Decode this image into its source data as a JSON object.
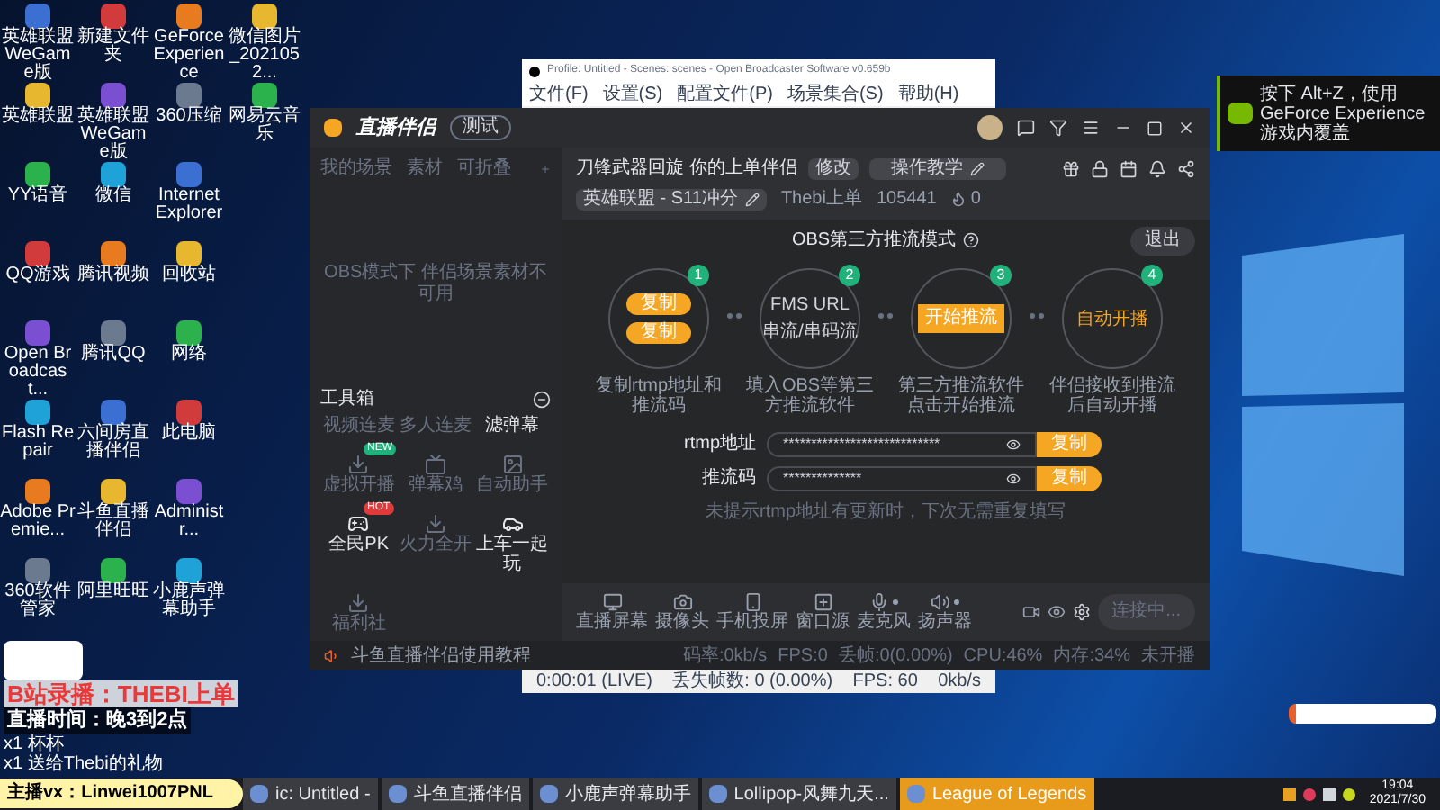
{
  "desktop": {
    "icon_columns": [
      [
        "英雄联盟WeGame版",
        "英雄联盟",
        "YY语音",
        "QQ游戏",
        "Open Broadcast...",
        "Flash Repair",
        "Adobe Premie...",
        "360软件管家"
      ],
      [
        "新建文件夹",
        "英雄联盟WeGame版",
        "微信",
        "腾讯视频",
        "腾讯QQ",
        "六间房直播伴侣",
        "斗鱼直播伴侣",
        "阿里旺旺"
      ],
      [
        "GeForce Experience",
        "360压缩",
        "Internet Explorer",
        "回收站",
        "网络",
        "此电脑",
        "Administr...",
        "小鹿声弹幕助手"
      ],
      [
        "微信图片_2021052...",
        "网易云音乐"
      ]
    ]
  },
  "notification": {
    "text": "按下 Alt+Z，使用 GeForce Experience 游戏内覆盖"
  },
  "obs_window": {
    "title": "Profile: Untitled - Scenes: scenes - Open Broadcaster Software v0.659b",
    "menu": [
      "文件(F)",
      "设置(S)",
      "配置文件(P)",
      "场景集合(S)",
      "帮助(H)"
    ],
    "status": [
      "0:00:01 (LIVE)",
      "丢失帧数: 0 (0.00%)",
      "FPS: 60",
      "0kb/s"
    ]
  },
  "app": {
    "name": "直播伴侣",
    "badge": "测试",
    "left_tabs": [
      "我的场景",
      "素材",
      "可折叠"
    ],
    "scene_note": "OBS模式下 伴侣场景素材不可用",
    "toolbox": {
      "title": "工具箱",
      "tools": [
        {
          "label": "视频连麦",
          "kind": "label_only",
          "disabled": true
        },
        {
          "label": "多人连麦",
          "kind": "label_only",
          "disabled": true
        },
        {
          "label": "滤弹幕",
          "kind": "label_only",
          "disabled": false
        },
        {
          "label": "虚拟开播",
          "kind": "icon",
          "badge": "NEW",
          "disabled": true
        },
        {
          "label": "弹幕鸡",
          "kind": "icon",
          "disabled": true
        },
        {
          "label": "自动助手",
          "kind": "icon",
          "disabled": true
        },
        {
          "label": "全民PK",
          "kind": "icon",
          "badge": "HOT",
          "disabled": false
        },
        {
          "label": "火力全开",
          "kind": "icon",
          "disabled": true
        },
        {
          "label": "上车一起玩",
          "kind": "icon",
          "disabled": false
        },
        {
          "label": "福利社",
          "kind": "icon",
          "disabled": true
        }
      ]
    },
    "stream": {
      "title": "刀锋武器回旋 你的上单伴侣",
      "edit": "修改",
      "tutorial": "操作教学",
      "category": "英雄联盟 - S11冲分",
      "host": "Thebi上单",
      "room": "105441",
      "popularity": "0"
    },
    "obs_mode": {
      "heading": "OBS第三方推流模式",
      "exit": "退出",
      "steps": [
        {
          "number": "1",
          "kind": "copy",
          "buttons": [
            "复制",
            "复制"
          ],
          "caption": "复制rtmp地址和推流码"
        },
        {
          "number": "2",
          "kind": "fields",
          "lines": [
            "FMS URL",
            "串流/串码流"
          ],
          "caption": "填入OBS等第三方推流软件"
        },
        {
          "number": "3",
          "kind": "button",
          "button": "开始推流",
          "caption": "第三方推流软件点击开始推流"
        },
        {
          "number": "4",
          "kind": "text",
          "text": "自动开播",
          "caption": "伴侣接收到推流后自动开播"
        }
      ],
      "fields": [
        {
          "label": "rtmp地址",
          "value": "****************************",
          "button": "复制"
        },
        {
          "label": "推流码",
          "value": "**************",
          "button": "复制"
        }
      ],
      "note": "未提示rtmp地址有更新时，下次无需重复填写"
    },
    "toolbar": [
      {
        "label": "直播屏幕",
        "kind": "plain"
      },
      {
        "label": "摄像头",
        "kind": "plain"
      },
      {
        "label": "手机投屏",
        "kind": "plain"
      },
      {
        "label": "窗口源",
        "kind": "plain"
      },
      {
        "label": "麦克风",
        "kind": "dotted"
      },
      {
        "label": "扬声器",
        "kind": "dotted"
      }
    ],
    "connect": {
      "label": "连接中...",
      "disabled": true
    },
    "status": {
      "tutorial": "斗鱼直播伴侣使用教程",
      "stats": [
        "码率:0kb/s",
        "FPS:0",
        "丢帧:0(0.00%)",
        "CPU:46%",
        "内存:34%",
        "未开播"
      ]
    }
  },
  "overlay": {
    "lines": [
      "B站录播：THEBI上单",
      "直播时间：晚3到2点"
    ],
    "gifts": [
      "x1 杯杯",
      "x1 送给Thebi的礼物"
    ],
    "contact": "主播vx：Linwei1007PNL"
  },
  "taskbar": {
    "items": [
      {
        "label": "ic: Untitled -",
        "selected": false
      },
      {
        "label": "斗鱼直播伴侣",
        "selected": false
      },
      {
        "label": "小鹿声弹幕助手",
        "selected": false
      },
      {
        "label": "Lollipop-风舞九天...",
        "selected": false
      },
      {
        "label": "League of Legends",
        "selected": true
      }
    ],
    "time": "19:04",
    "date": "2021/7/30"
  }
}
